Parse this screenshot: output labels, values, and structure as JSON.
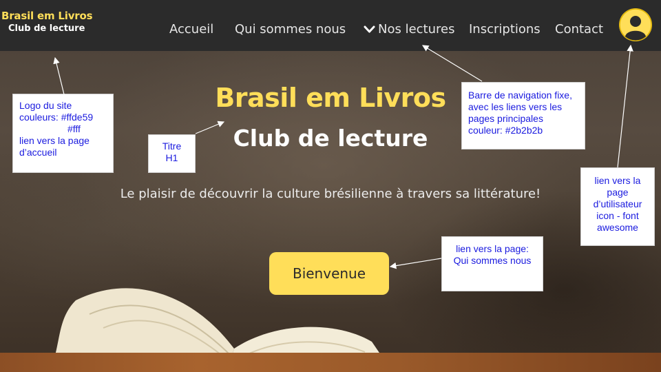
{
  "navbar": {
    "logo": {
      "title": "Brasil em Livros",
      "subtitle": "Club de lecture"
    },
    "links": {
      "home": "Accueil",
      "about": "Qui sommes nous",
      "readings": "Nos lectures",
      "signup": "Inscriptions",
      "contact": "Contact"
    },
    "user_icon": "user-circle-icon",
    "dropdown_icon": "chevron-down-icon"
  },
  "hero": {
    "title": "Brasil em Livros",
    "subtitle": "Club de lecture",
    "tagline": "Le plaisir de découvrir la culture brésilienne à travers sa littérature!",
    "cta_label": "Bienvenue"
  },
  "annotations": {
    "logo_note": [
      "Logo du site",
      "couleurs:  #ffde59",
      "#fff",
      "lien vers la page",
      "d’accueil"
    ],
    "title_note": [
      "Titre",
      "H1"
    ],
    "nav_note": [
      "Barre de navigation fixe,",
      "avec les liens vers les",
      "pages principales",
      "couleur: #2b2b2b"
    ],
    "user_note": [
      "lien vers la",
      "page",
      "d’utilisateur",
      "icon - font",
      "awesome"
    ],
    "cta_note": [
      "lien vers la page:",
      "Qui sommes nous"
    ]
  },
  "colors": {
    "accent": "#ffde59",
    "navbar": "#2b2b2b",
    "white": "#ffffff",
    "annotation_text": "#1a1adf"
  }
}
